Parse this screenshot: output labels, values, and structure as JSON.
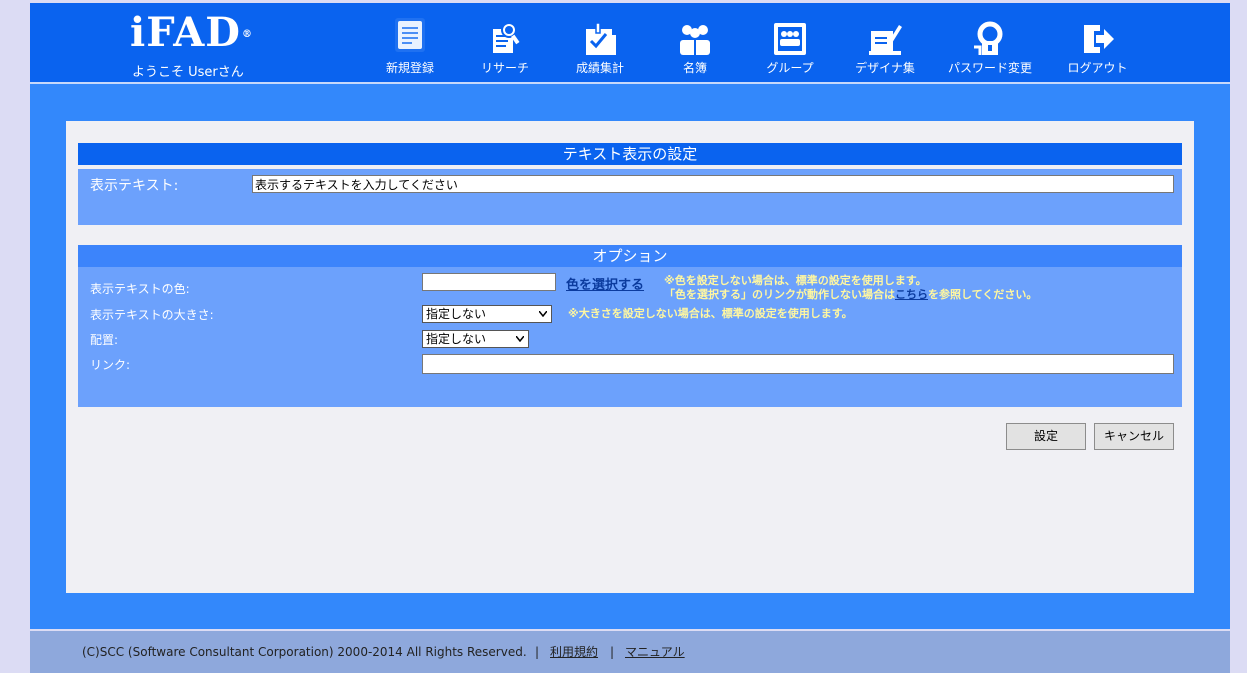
{
  "header": {
    "logo": "iFAD",
    "logo_mark": "®",
    "welcome": "ようこそ Userさん"
  },
  "nav": [
    {
      "label": "新規登録",
      "icon": "new-document-icon",
      "active": true
    },
    {
      "label": "リサーチ",
      "icon": "research-icon"
    },
    {
      "label": "成績集計",
      "icon": "results-icon"
    },
    {
      "label": "名簿",
      "icon": "roster-icon"
    },
    {
      "label": "グループ",
      "icon": "group-icon"
    },
    {
      "label": "デザイナ集",
      "icon": "designer-icon"
    },
    {
      "label": "パスワード変更",
      "icon": "password-icon"
    },
    {
      "label": "ログアウト",
      "icon": "logout-icon"
    }
  ],
  "text_section": {
    "title": "テキスト表示の設定",
    "label": "表示テキスト:",
    "value": "表示するテキストを入力してください"
  },
  "options": {
    "title": "オプション",
    "color_label": "表示テキストの色:",
    "color_value": "",
    "pick_color_link": "色を選択する",
    "color_note_1": "※色を設定しない場合は、標準の設定を使用します。",
    "color_note_2a": "「色を選択する」のリンクが動作しない場合は",
    "color_note_2_link": "こちら",
    "color_note_2b": "を参照してください。",
    "size_label": "表示テキストの大きさ:",
    "size_value": "指定しない",
    "size_note": "※大きさを設定しない場合は、標準の設定を使用します。",
    "align_label": "配置:",
    "align_value": "指定しない",
    "link_label": "リンク:",
    "link_value": ""
  },
  "buttons": {
    "ok": "設定",
    "cancel": "キャンセル"
  },
  "footer": {
    "copyright": "(C)SCC (Software Consultant Corporation) 2000-2014 All Rights Reserved.",
    "sep": "|",
    "terms": "利用規約",
    "manual": "マニュアル"
  },
  "colors": {
    "header_bg": "#0a63ef",
    "main_bg": "#3388fb",
    "section_title_bg": "#0a63ef",
    "option_title_bg": "#3c84fb",
    "section_body_bg": "#6ca1fc",
    "footer_bg": "#8ea8dc"
  }
}
